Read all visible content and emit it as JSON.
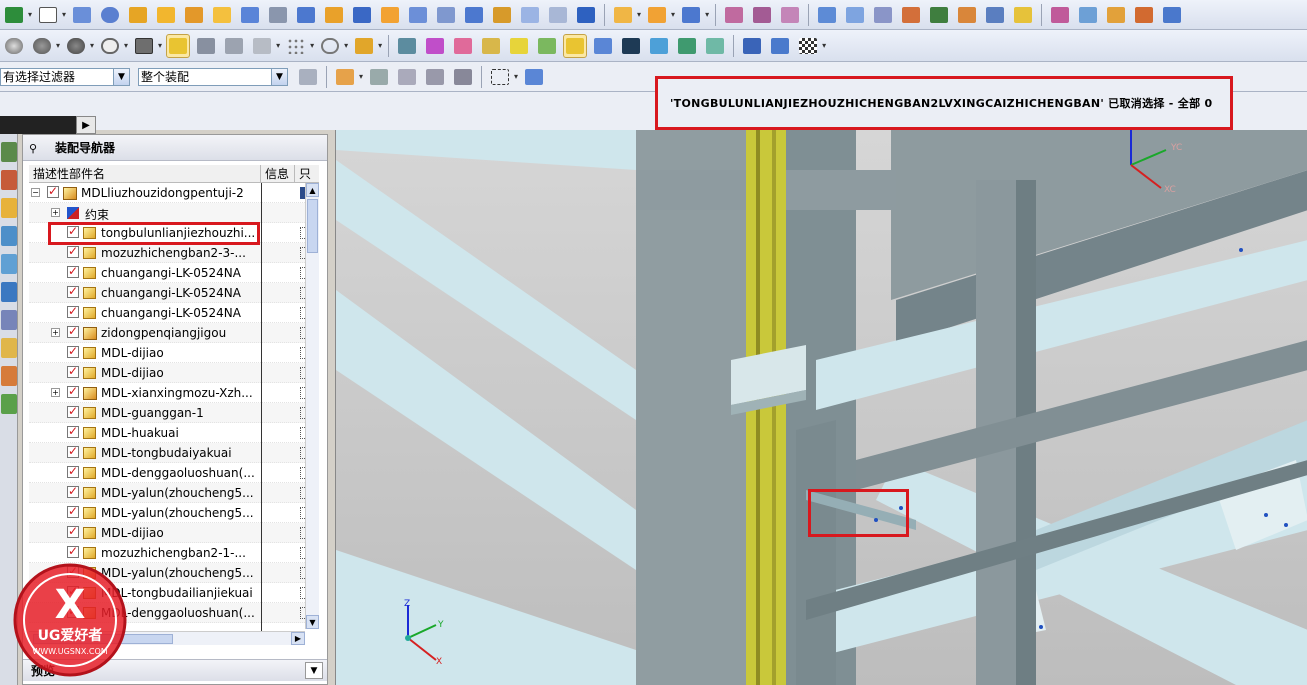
{
  "filter": {
    "selection_filter": "有选择过滤器",
    "scope": "整个装配"
  },
  "status_message": "'TONGBULUNLIANJIEZHOUZHICHENGBAN2LVXINGCAIZHICHENGBAN' 已取消选择 - 全部 0",
  "navigator": {
    "title": "装配导航器",
    "columns": {
      "name": "描述性部件名",
      "info": "信息",
      "readonly": "只"
    },
    "rows": [
      {
        "label": "MDLliuzhouzidongpentuji-2",
        "kind": "root"
      },
      {
        "label": "约束",
        "kind": "constraint"
      },
      {
        "label": "tongbulunlianjiezhouzhi...",
        "kind": "part"
      },
      {
        "label": "mozuzhichengban2-3-...",
        "kind": "part"
      },
      {
        "label": "chuangangi-LK-0524NA",
        "kind": "part"
      },
      {
        "label": "chuangangi-LK-0524NA",
        "kind": "part"
      },
      {
        "label": "chuangangi-LK-0524NA",
        "kind": "part"
      },
      {
        "label": "zidongpenqiangjigou",
        "kind": "asm"
      },
      {
        "label": "MDL-dijiao",
        "kind": "part"
      },
      {
        "label": "MDL-dijiao",
        "kind": "part"
      },
      {
        "label": "MDL-xianxingmozu-Xzh...",
        "kind": "asm"
      },
      {
        "label": "MDL-guanggan-1",
        "kind": "part"
      },
      {
        "label": "MDL-huakuai",
        "kind": "part"
      },
      {
        "label": "MDL-tongbudaiyakuai",
        "kind": "part"
      },
      {
        "label": "MDL-denggaoluoshuan(...",
        "kind": "part"
      },
      {
        "label": "MDL-yalun(zhoucheng5...",
        "kind": "part"
      },
      {
        "label": "MDL-yalun(zhoucheng5...",
        "kind": "part"
      },
      {
        "label": "MDL-dijiao",
        "kind": "part"
      },
      {
        "label": "mozuzhichengban2-1-...",
        "kind": "part"
      },
      {
        "label": "MDL-yalun(zhoucheng5...",
        "kind": "part"
      },
      {
        "label": "MDL-tongbudailianjiekuai",
        "kind": "part"
      },
      {
        "label": "MDL-denggaoluoshuan(...",
        "kind": "part"
      }
    ],
    "preview_label": "预览"
  },
  "triad": {
    "x": "XC",
    "y": "YC",
    "z": "Z"
  },
  "view_triad": {
    "x": "X",
    "y": "Y",
    "z": "Z"
  },
  "watermark": {
    "brand": "UG爱好者",
    "url": "WWW.UGSNX.COM"
  },
  "colors": {
    "highlight": "#d8181e",
    "beam": "#6f7f83",
    "steel_light": "#cfe6ec",
    "rail_yellow": "#c9c83a"
  }
}
